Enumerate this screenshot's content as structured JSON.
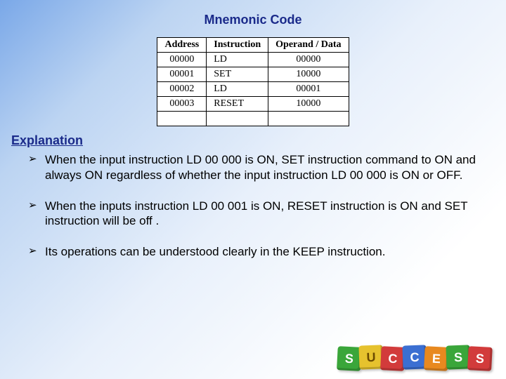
{
  "title": "Mnemonic Code",
  "table": {
    "headers": {
      "address": "Address",
      "instruction": "Instruction",
      "operand": "Operand / Data"
    },
    "rows": [
      {
        "address": "00000",
        "instruction": "LD",
        "operand": "00000"
      },
      {
        "address": "00001",
        "instruction": "SET",
        "operand": "10000"
      },
      {
        "address": "00002",
        "instruction": "LD",
        "operand": "00001"
      },
      {
        "address": "00003",
        "instruction": "RESET",
        "operand": "10000"
      },
      {
        "address": "",
        "instruction": "",
        "operand": ""
      }
    ]
  },
  "explanation_heading": "Explanation",
  "bullets": [
    "When the input instruction LD 00 000 is ON, SET instruction command to ON and always ON regardless of whether the input instruction LD 00 000 is ON or OFF.",
    "When the inputs instruction LD 00 001 is ON, RESET instruction is ON and SET instruction will be off .",
    "Its operations can be understood clearly in the KEEP instruction."
  ],
  "success_blocks": [
    "S",
    "U",
    "C",
    "C",
    "E",
    "S",
    "S"
  ],
  "chart_data": {
    "type": "table",
    "title": "Mnemonic Code",
    "columns": [
      "Address",
      "Instruction",
      "Operand / Data"
    ],
    "rows": [
      [
        "00000",
        "LD",
        "00000"
      ],
      [
        "00001",
        "SET",
        "10000"
      ],
      [
        "00002",
        "LD",
        "00001"
      ],
      [
        "00003",
        "RESET",
        "10000"
      ]
    ]
  }
}
